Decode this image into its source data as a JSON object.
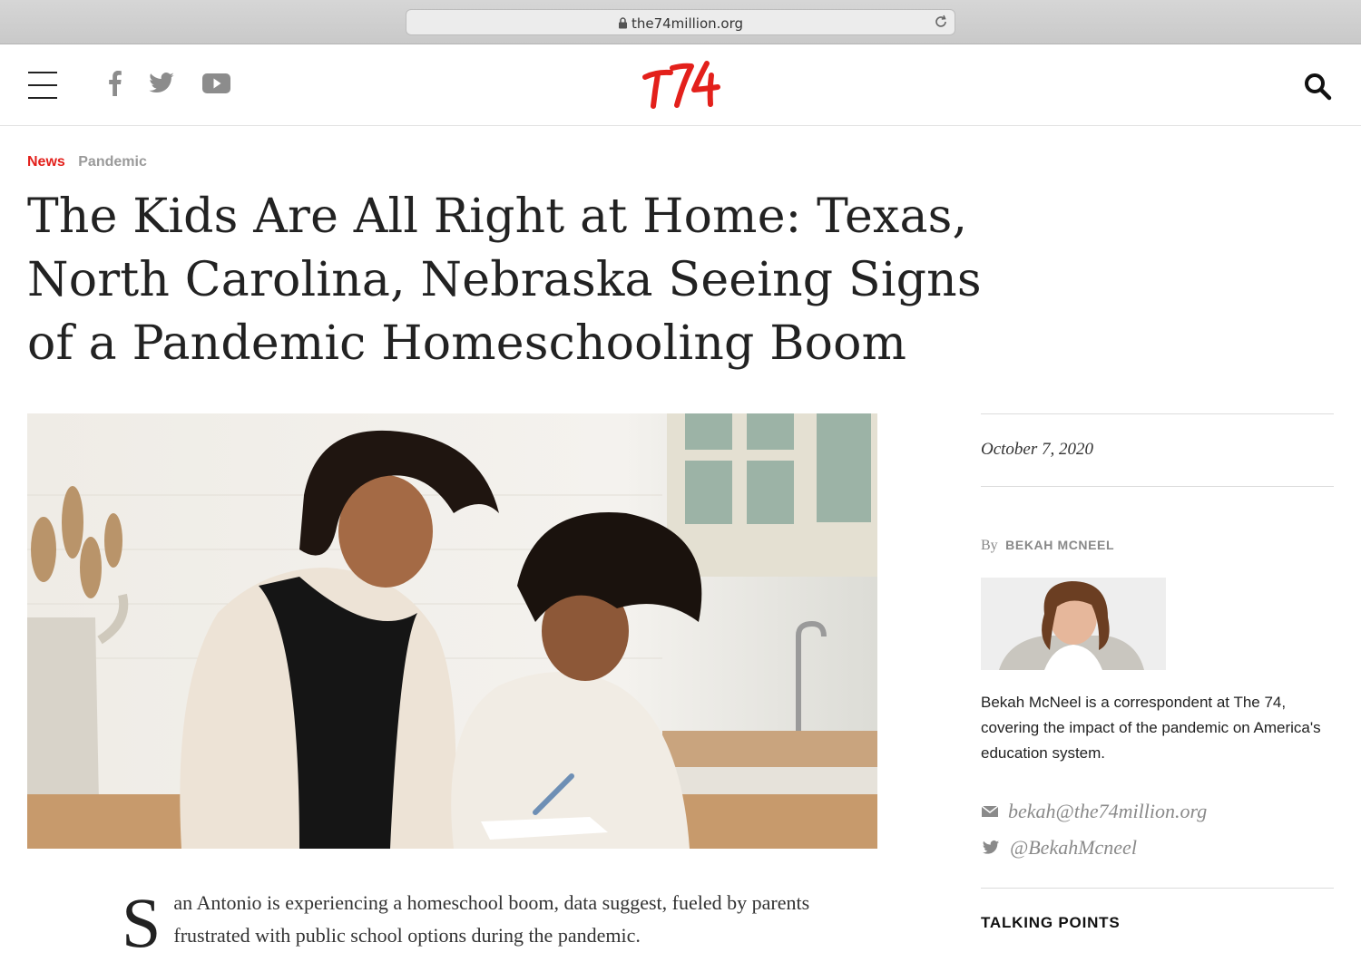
{
  "browser": {
    "url": "the74million.org"
  },
  "header": {
    "logo_text": "T74",
    "brand_color": "#e3201b",
    "social_icons": [
      "facebook-icon",
      "twitter-icon",
      "youtube-icon"
    ]
  },
  "breadcrumb": {
    "section": "News",
    "topic": "Pandemic"
  },
  "article": {
    "headline": "The Kids Are All Right at Home: Texas, North Carolina, Nebraska Seeing Signs of a Pandemic Homeschooling Boom",
    "dropcap": "S",
    "lead": "an Antonio is experiencing a homeschool boom, data suggest, fueled by parents frustrated with public school options during the pandemic."
  },
  "sidebar": {
    "date": "October 7, 2020",
    "by_label": "By",
    "author": "BEKAH MCNEEL",
    "bio": "Bekah McNeel is a correspondent at The 74, covering the impact of the pandemic on America's education system.",
    "email": "bekah@the74million.org",
    "twitter": "@BekahMcneel",
    "section_heading": "TALKING POINTS"
  }
}
